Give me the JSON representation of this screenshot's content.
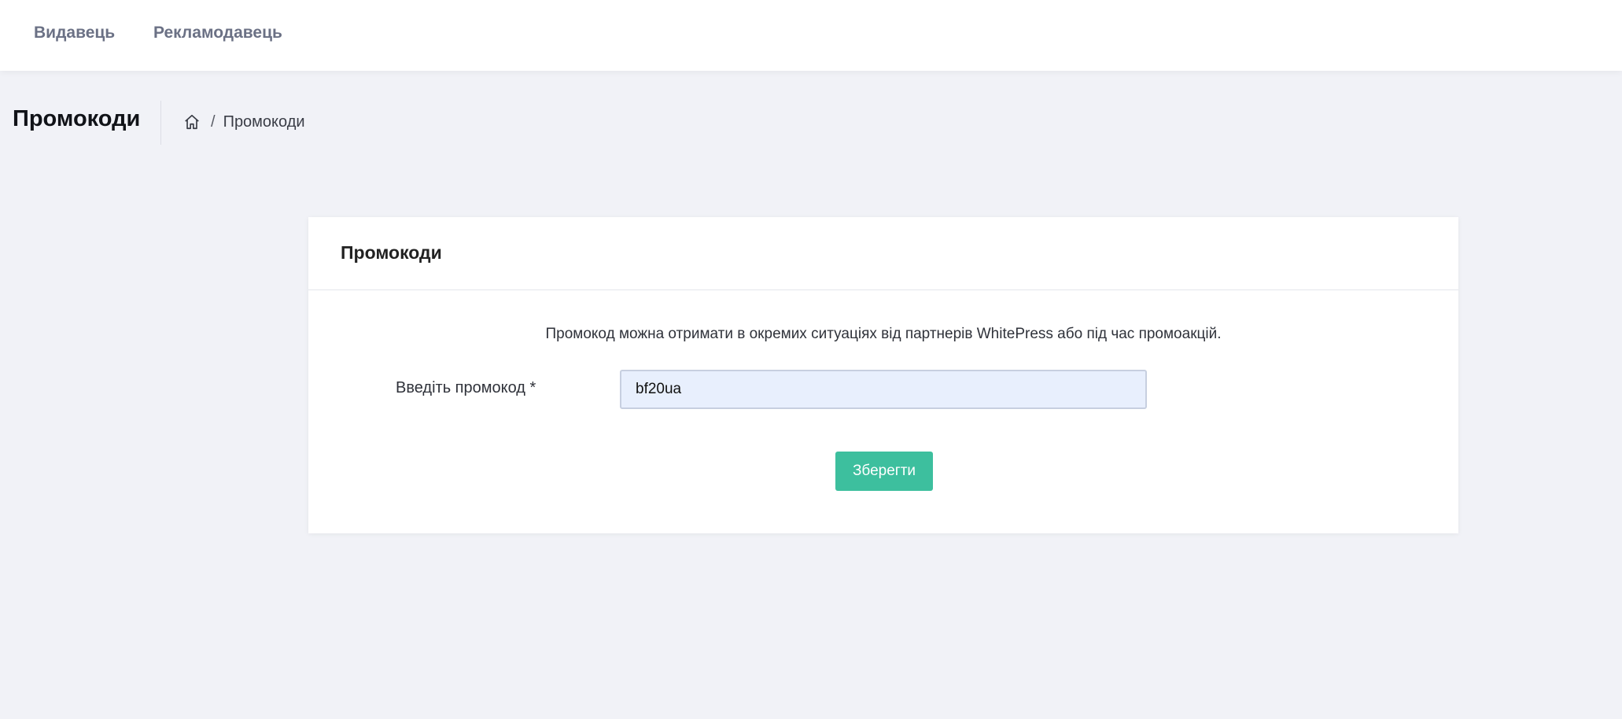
{
  "nav": {
    "publisher": "Видавець",
    "advertiser": "Рекламодавець"
  },
  "subheader": {
    "title": "Промокоди",
    "breadcrumb": {
      "home_icon": "home-icon",
      "separator": "/",
      "current": "Промокоди"
    }
  },
  "card": {
    "title": "Промокоди",
    "info": "Промокод можна отримати в окремих ситуаціях від партнерів WhitePress або під час промоакцій.",
    "field_label": "Введіть промокод *",
    "input_value": "bf20ua",
    "save_label": "Зберегти"
  },
  "colors": {
    "background": "#f1f2f7",
    "accent": "#3dbf9e",
    "input_background": "#e8effd"
  }
}
